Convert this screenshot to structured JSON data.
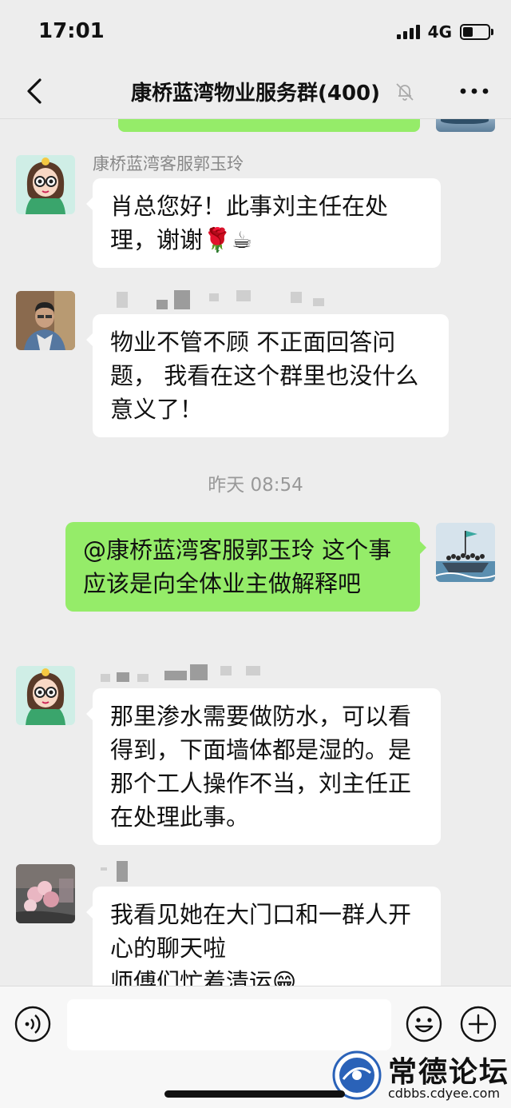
{
  "status_bar": {
    "time": "17:01",
    "network": "4G"
  },
  "nav": {
    "title": "康桥蓝湾物业服务群(400)"
  },
  "messages": [
    {
      "sender": "康桥蓝湾客服郭玉玲",
      "text": "肖总您好！此事刘主任在处理，谢谢🌹☕"
    },
    {
      "text": "物业不管不顾 不正面回答问题， 我看在这个群里也没什么意义了！"
    },
    {
      "text": "@康桥蓝湾客服郭玉玲 这个事应该是向全体业主做解释吧"
    },
    {
      "text": "那里渗水需要做防水，可以看得到，下面墙体都是湿的。是那个工人操作不当，刘主任正在处理此事。"
    },
    {
      "text": "我看见她在大门口和一群人开心的聊天啦\n师傅们忙着清运😁"
    }
  ],
  "timestamp": "昨天 08:54",
  "watermark": {
    "brand": "常德论坛",
    "url": "cdbbs.cdyee.com"
  },
  "colors": {
    "self_bubble": "#95ec69",
    "background": "#ededed"
  }
}
